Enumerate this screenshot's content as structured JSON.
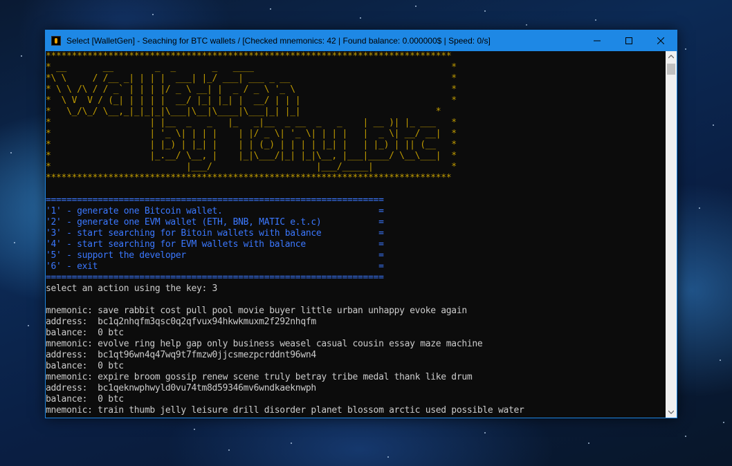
{
  "window": {
    "title": "Select [WalletGen] - Seaching for BTC wallets / [Checked mnemonics: 42 | Found balance: 0.000000$ | Speed: 0/s]",
    "app_icon": "console-app-icon",
    "controls": [
      "minimize-icon",
      "maximize-icon",
      "close-icon"
    ],
    "accent_color": "#1e88e5"
  },
  "banner": {
    "color": "#c19c00",
    "lines": [
      "******************************************************************************",
      "* __       __        _  _       _   ____                                      *",
      "*\\ \\     / /__ _| | | |  ___| |_/ ___| ___ _ __                               *",
      "* \\ \\ /\\ / / _` | | | |/ _ \\ __| |  _ / _ \\ '_ \\                              *",
      "*  \\ V  V / (_| | | | |  __/ |_| |_| |  __/ | | |                             *",
      "*   \\_/\\_/ \\__,_|_|_|_|\\___|\\__|\\____|\\___|_| |_|                          *",
      "*                   | |__  _   _   |_   _|__  _ __  _   _    | __ )| |_ ___   *",
      "*                   | '_ \\| | | |    | |/ _ \\| '_ \\| | | |   |  _ \\| __/ __|  *",
      "*                   | |_) | |_| |    | | (_) | | | | |_| |   | |_) | || (__   *",
      "*                   |_.__/ \\__, |    |_|\\___/|_| |_|\\__, |___|____/ \\__\\___|  *",
      "*                          |___/                    |___/_____|               *",
      "******************************************************************************"
    ]
  },
  "menu": {
    "color": "#3b78ff",
    "border": "=================================================================",
    "items": [
      "'1' - generate one Bitcoin wallet.                              =",
      "'2' - generate one EVM wallet (ETH, BNB, MATIC e.t.c)           =",
      "'3' - start searching for Bitoin wallets with balance           =",
      "'4' - start searching for EVM wallets with balance              =",
      "'5' - support the developer                                     =",
      "'6' - exit                                                      ="
    ]
  },
  "prompt": "select an action using the key: 3",
  "output": [
    "",
    "mnemonic: save rabbit cost pull pool movie buyer little urban unhappy evoke again",
    "address:  bc1q2nhqfm3qsc0q2qfvux94hkwkmuxm2f292nhqfm",
    "balance:  0 btc",
    "mnemonic: evolve ring help gap only business weasel casual cousin essay maze machine",
    "address:  bc1qt96wn4q47wq9t7fmzw0jjcsmezpcrddnt96wn4",
    "balance:  0 btc",
    "mnemonic: expire broom gossip renew scene truly betray tribe medal thank like drum",
    "address:  bc1qeknwphwyld0vu74tm8d59346mv6wndkaeknwph",
    "balance:  0 btc",
    "mnemonic: train thumb jelly leisure drill disorder planet blossom arctic used possible water"
  ]
}
